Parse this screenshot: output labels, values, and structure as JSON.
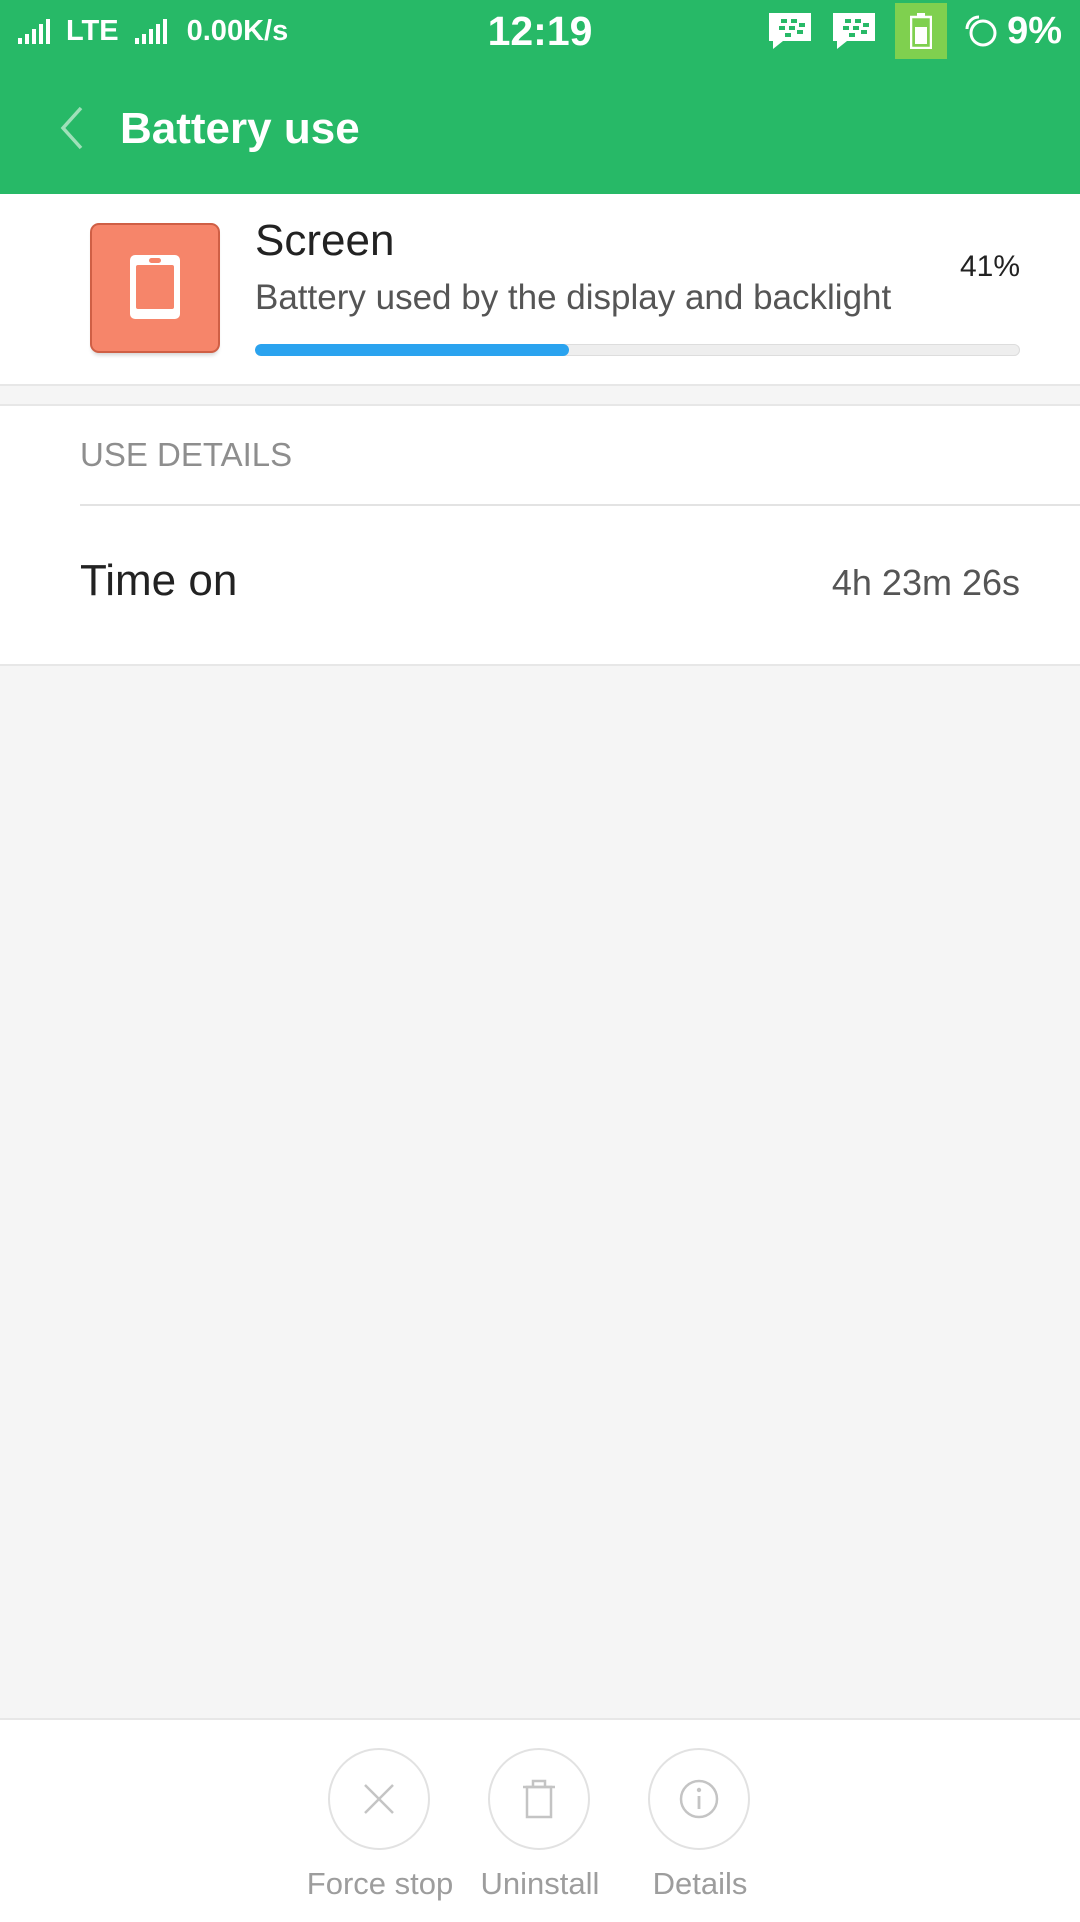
{
  "status_bar": {
    "network": "LTE",
    "speed": "0.00K/s",
    "time": "12:19",
    "battery": "9%",
    "icons": [
      "signal-icon",
      "signal-icon",
      "bbm-icon",
      "bbm-icon",
      "battery-saver-icon",
      "ring-icon"
    ]
  },
  "header": {
    "title": "Battery use",
    "back_icon": "chevron-left-icon",
    "color": "#27b967"
  },
  "item": {
    "name": "Screen",
    "description": "Battery used by the display and backlight",
    "percent": "41%",
    "usage_fraction": 0.41,
    "icon": "device-screen-icon",
    "icon_color": "#f6856a",
    "bar_color": "#2aa3ef"
  },
  "details": {
    "section_title": "USE DETAILS",
    "rows": [
      {
        "label": "Time on",
        "value": "4h 23m 26s"
      }
    ]
  },
  "actions": [
    {
      "label": "Force stop",
      "icon": "close-icon"
    },
    {
      "label": "Uninstall",
      "icon": "trash-icon"
    },
    {
      "label": "Details",
      "icon": "info-icon"
    }
  ]
}
